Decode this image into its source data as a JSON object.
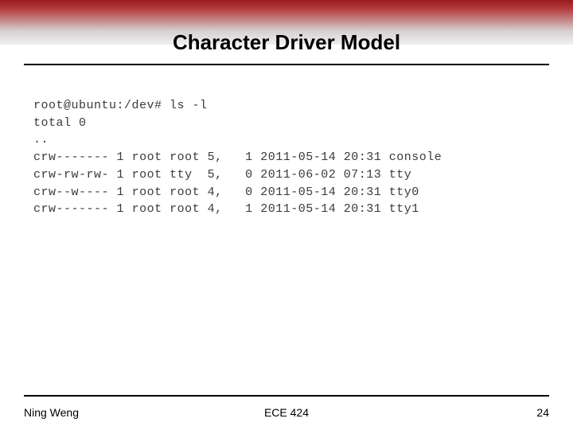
{
  "title": "Character Driver Model",
  "terminal": {
    "prompt": "root@ubuntu:/dev# ls -l",
    "total_line": "total 0",
    "dotdot": "..",
    "rows": [
      {
        "perms": "crw-------",
        "links": "1",
        "owner": "root",
        "group": "root",
        "major": "5,",
        "minor": "1",
        "date": "2011-05-14",
        "time": "20:31",
        "name": "console"
      },
      {
        "perms": "crw-rw-rw-",
        "links": "1",
        "owner": "root",
        "group": "tty ",
        "major": "5,",
        "minor": "0",
        "date": "2011-06-02",
        "time": "07:13",
        "name": "tty"
      },
      {
        "perms": "crw--w----",
        "links": "1",
        "owner": "root",
        "group": "root",
        "major": "4,",
        "minor": "0",
        "date": "2011-05-14",
        "time": "20:31",
        "name": "tty0"
      },
      {
        "perms": "crw-------",
        "links": "1",
        "owner": "root",
        "group": "root",
        "major": "4,",
        "minor": "1",
        "date": "2011-05-14",
        "time": "20:31",
        "name": "tty1"
      }
    ]
  },
  "footer": {
    "left": "Ning Weng",
    "center": "ECE 424",
    "right": "24"
  }
}
